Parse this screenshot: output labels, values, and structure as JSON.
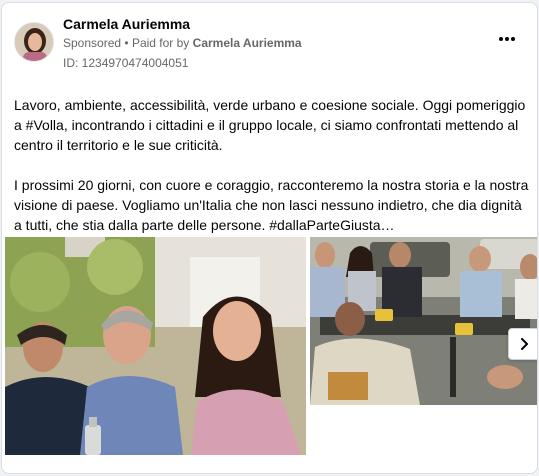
{
  "post": {
    "author": "Carmela Auriemma",
    "sponsored_label": "Sponsored",
    "separator": "•",
    "paid_for_prefix": "Paid for by",
    "paid_for_name": "Carmela Auriemma",
    "library_id": "ID: 1234970474004051",
    "paragraph_1": "Lavoro, ambiente, accessibilità, verde urbano e coesione sociale. Oggi pomeriggio a #Volla, incontrando i cittadini e il gruppo locale, ci siamo confrontati mettendo al centro il territorio e le sue criticità.",
    "paragraph_2": "I prossimi 20 giorni, con cuore e coraggio, racconteremo la nostra storia e la nostra visione di paese. Vogliamo un'Italia che non lasci nessuno indietro, che dia dignità a tutti, che stia dalla parte delle persone. #dallaParteGiusta…"
  },
  "icons": {
    "more": "three-dots-icon",
    "next": "chevron-right-icon"
  },
  "colors": {
    "text_primary": "#050505",
    "text_secondary": "#65676b",
    "card_bg": "#ffffff",
    "page_bg": "#f0f2f5"
  }
}
